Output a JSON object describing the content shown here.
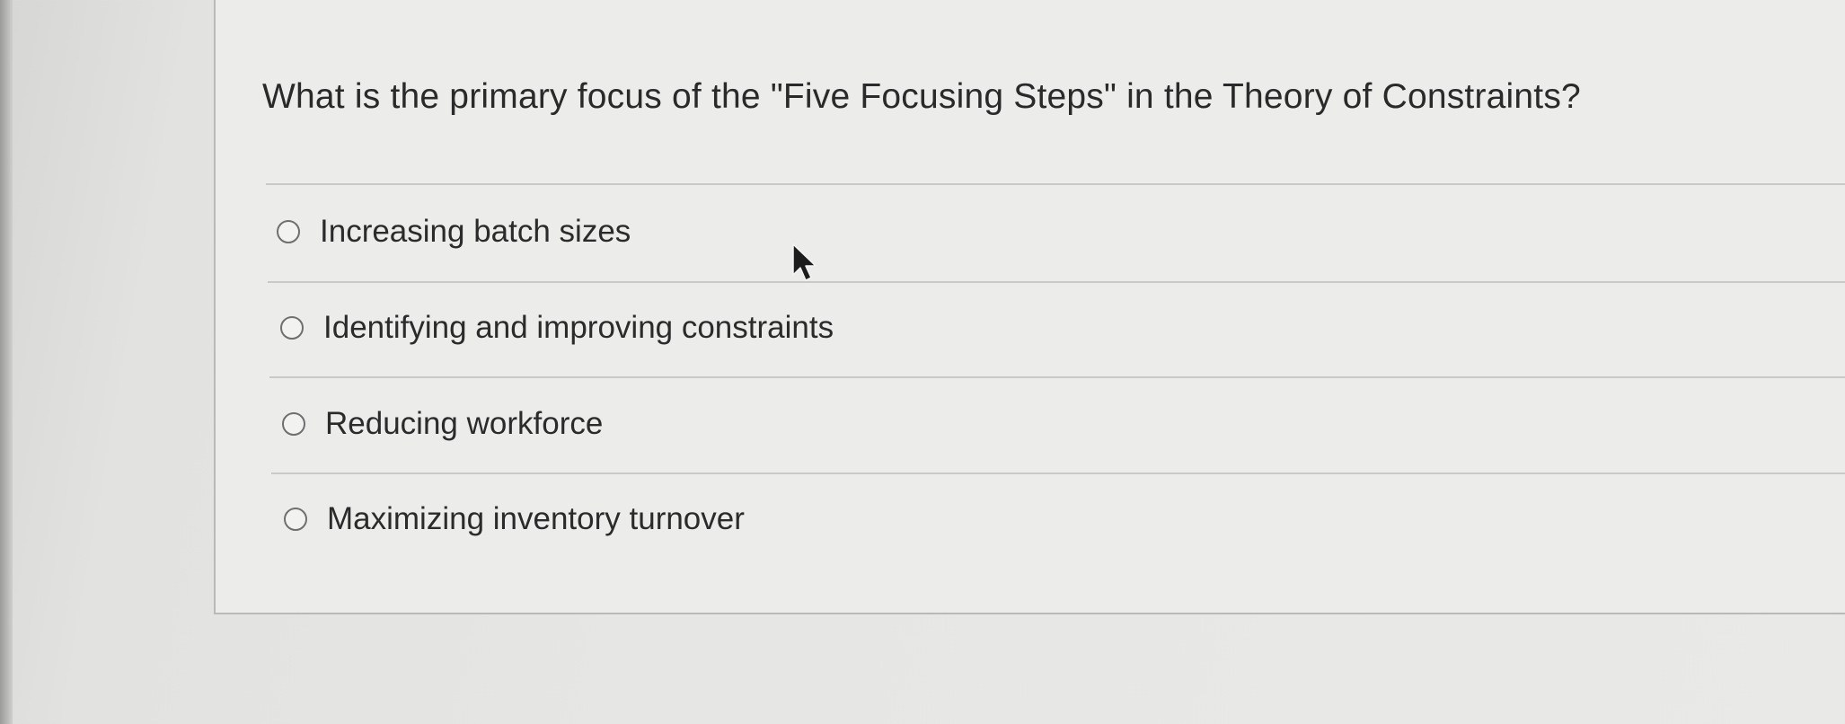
{
  "question": {
    "text": "What is the primary focus of the \"Five Focusing Steps\" in the Theory of Constraints?"
  },
  "options": [
    {
      "label": "Increasing batch sizes",
      "selected": false
    },
    {
      "label": "Identifying and improving constraints",
      "selected": false
    },
    {
      "label": "Reducing workforce",
      "selected": false
    },
    {
      "label": "Maximizing inventory turnover",
      "selected": false
    }
  ],
  "icons": {
    "radio": "radio-unselected-icon",
    "pointer": "mouse-pointer-icon"
  },
  "colors": {
    "background": "#e6e6e4",
    "card": "#ececea",
    "text": "#2a2a2a",
    "radio_border": "#6f6f6f",
    "divider": "#c9c9c7"
  }
}
